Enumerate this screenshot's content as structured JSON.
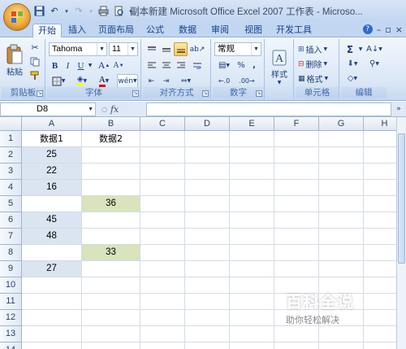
{
  "window": {
    "title": "副本新建 Microsoft Office Excel 2007 工作表 - Microso..."
  },
  "tabs": [
    "开始",
    "插入",
    "页面布局",
    "公式",
    "数据",
    "审阅",
    "视图",
    "开发工具"
  ],
  "ribbon": {
    "clipboard": {
      "paste_label": "粘贴",
      "group_label": "剪贴板"
    },
    "font": {
      "font_name": "Tahoma",
      "font_size": "11",
      "bold": "B",
      "italic": "I",
      "underline": "U",
      "grow_font": "A",
      "shrink_font": "A",
      "phonetic": "wén",
      "group_label": "字体"
    },
    "alignment": {
      "group_label": "对齐方式"
    },
    "number": {
      "format": "常规",
      "percent": "%",
      "comma": ",",
      "group_label": "数字"
    },
    "styles": {
      "styles_label": "样式"
    },
    "cells": {
      "insert_label": "插入",
      "delete_label": "删除",
      "format_label": "格式",
      "group_label": "单元格"
    },
    "editing": {
      "sum": "Σ",
      "group_label": "编辑"
    }
  },
  "formula_bar": {
    "name_box": "D8",
    "fx": "fx",
    "formula": ""
  },
  "sheet": {
    "columns": [
      "A",
      "B",
      "C",
      "D",
      "E",
      "F",
      "G",
      "H"
    ],
    "rows": [
      "1",
      "2",
      "3",
      "4",
      "5",
      "6",
      "7",
      "8",
      "9",
      "10",
      "11",
      "12",
      "13",
      "14"
    ],
    "header_a": "数据1",
    "header_b": "数据2",
    "col_a": [
      "25",
      "22",
      "16",
      "",
      "45",
      "48",
      "",
      "27"
    ],
    "col_b": [
      "",
      "",
      "",
      "36",
      "",
      "",
      "33",
      ""
    ]
  },
  "watermark": {
    "title": "百科全说",
    "subtitle": "助你轻松解决"
  },
  "colors": {
    "highlight_blue": "#dbe5f1",
    "highlight_green": "#d7e4bc",
    "ribbon_bg": "#dbe7f6"
  }
}
